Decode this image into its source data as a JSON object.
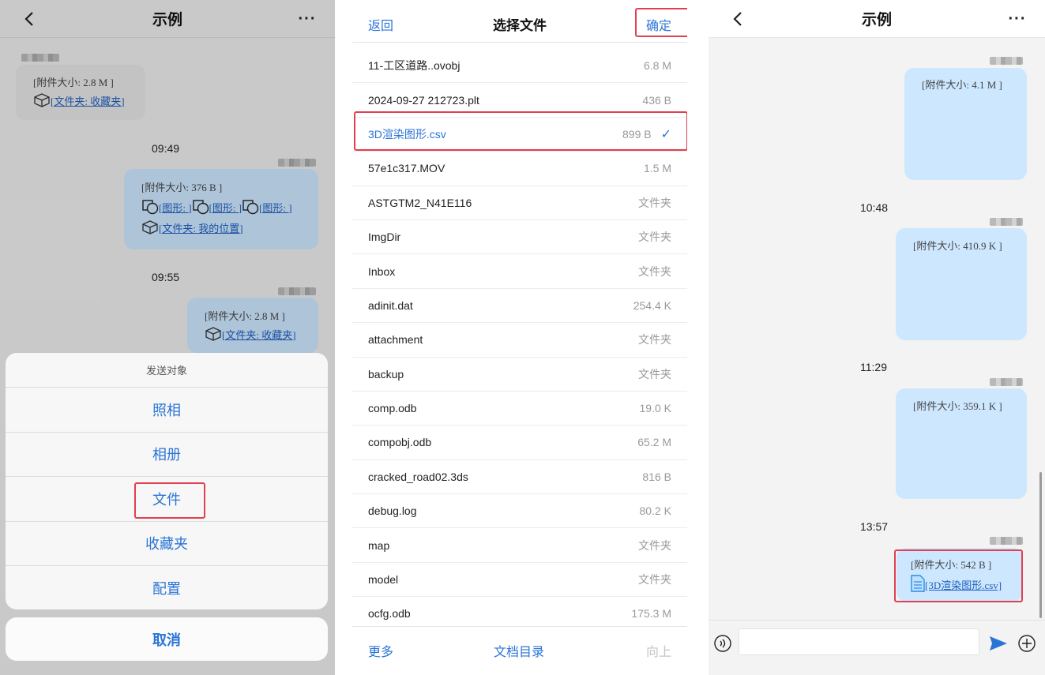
{
  "panel1": {
    "nav": {
      "title": "示例",
      "more": "···"
    },
    "messages": [
      {
        "size": "[附件大小: 2.8 M ]",
        "links": [
          "[文件夹: 收藏夹]"
        ]
      },
      {
        "time": "09:49",
        "size": "[附件大小: 376 B ]",
        "links": [
          "[图形: ]",
          "[图形: ]",
          "[图形: ]",
          "[文件夹: 我的位置]"
        ]
      },
      {
        "time": "09:55",
        "size": "[附件大小: 2.8 M ]",
        "links": [
          "[文件夹: 收藏夹]"
        ]
      }
    ],
    "sheet": {
      "title": "发送对象",
      "options": [
        "照相",
        "相册",
        "文件",
        "收藏夹",
        "配置"
      ],
      "cancel": "取消"
    }
  },
  "panel2": {
    "header": {
      "back": "返回",
      "title": "选择文件",
      "confirm": "确定"
    },
    "files": [
      {
        "name": "11-工区道路..ovobj",
        "size": "6.8 M"
      },
      {
        "name": "2024-09-27 212723.plt",
        "size": "436 B"
      },
      {
        "name": "3D渲染图形.csv",
        "size": "899 B",
        "selected": true
      },
      {
        "name": "57e1c317.MOV",
        "size": "1.5 M"
      },
      {
        "name": "ASTGTM2_N41E116",
        "size": "文件夹"
      },
      {
        "name": "ImgDir",
        "size": "文件夹"
      },
      {
        "name": "Inbox",
        "size": "文件夹"
      },
      {
        "name": "adinit.dat",
        "size": "254.4 K"
      },
      {
        "name": "attachment",
        "size": "文件夹"
      },
      {
        "name": "backup",
        "size": "文件夹"
      },
      {
        "name": "comp.odb",
        "size": "19.0 K"
      },
      {
        "name": "compobj.odb",
        "size": "65.2 M"
      },
      {
        "name": "cracked_road02.3ds",
        "size": "816 B"
      },
      {
        "name": "debug.log",
        "size": "80.2 K"
      },
      {
        "name": "map",
        "size": "文件夹"
      },
      {
        "name": "model",
        "size": "文件夹"
      },
      {
        "name": "ocfg.odb",
        "size": "175.3 M"
      }
    ],
    "footer": {
      "more": "更多",
      "docs": "文档目录",
      "up": "向上"
    }
  },
  "panel3": {
    "nav": {
      "title": "示例",
      "more": "···"
    },
    "messages": [
      {
        "size": "[附件大小: 4.1 M ]"
      },
      {
        "time": "10:48",
        "size": "[附件大小: 410.9 K ]"
      },
      {
        "time": "11:29",
        "size": "[附件大小: 359.1 K ]"
      },
      {
        "time": "13:57",
        "size": "[附件大小: 542 B ]",
        "link": "[3D渲染图形.csv]"
      }
    ]
  },
  "colors": {
    "accent": "#2a74d6",
    "highlight": "#e0404f",
    "bubble_out": "#cde7ff"
  }
}
